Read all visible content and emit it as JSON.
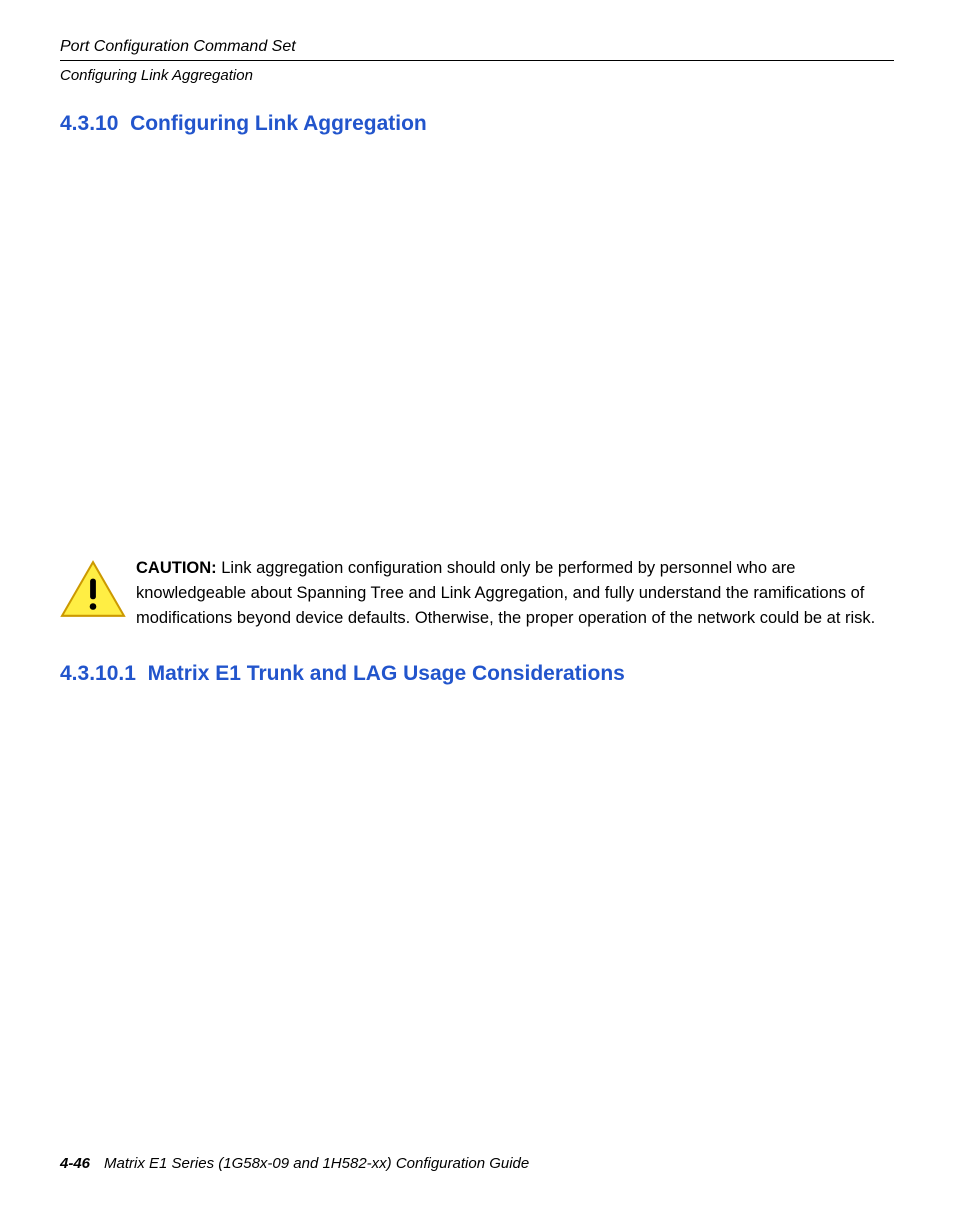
{
  "header": {
    "line1": "Port Configuration Command Set",
    "line2": "Configuring Link Aggregation"
  },
  "section": {
    "number": "4.3.10",
    "title": "Configuring Link Aggregation"
  },
  "caution": {
    "label": "CAUTION:",
    "text": "Link aggregation configuration should only be performed by personnel who are knowledgeable about Spanning Tree and Link Aggregation, and fully understand the ramifications of modifications beyond device defaults. Otherwise, the proper operation of the network could be at risk."
  },
  "subsection": {
    "number": "4.3.10.1",
    "title": "Matrix E1 Trunk and LAG Usage Considerations"
  },
  "footer": {
    "page": "4-46",
    "docTitle": "Matrix E1 Series (1G58x-09 and 1H582-xx) Configuration Guide"
  }
}
